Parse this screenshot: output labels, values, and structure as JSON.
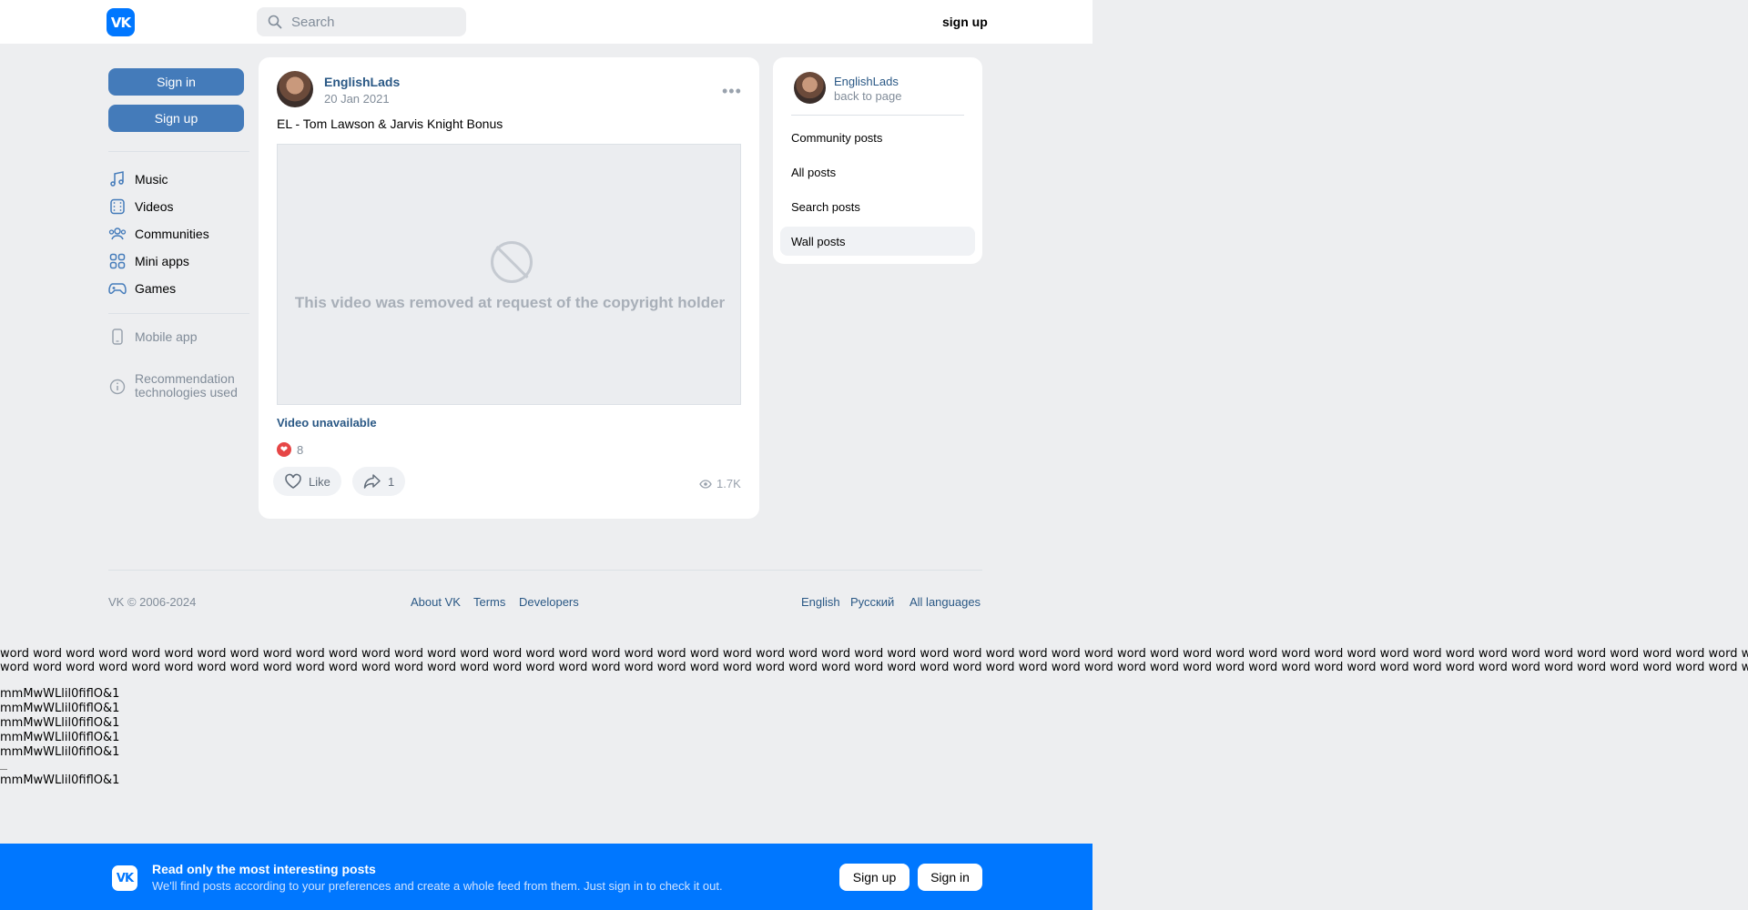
{
  "header": {
    "logo_text": "VK",
    "search_placeholder": "Search",
    "signup_link": "sign up"
  },
  "sidebar": {
    "sign_in": "Sign in",
    "sign_up": "Sign up",
    "items": [
      {
        "label": "Music",
        "icon": "music-icon"
      },
      {
        "label": "Videos",
        "icon": "video-icon"
      },
      {
        "label": "Communities",
        "icon": "communities-icon"
      },
      {
        "label": "Mini apps",
        "icon": "mini-apps-icon"
      },
      {
        "label": "Games",
        "icon": "games-icon"
      }
    ],
    "mobile_app": "Mobile app",
    "recommendation_line1": "Recommendation",
    "recommendation_line2": "technologies used"
  },
  "post": {
    "author": "EnglishLads",
    "date": "20 Jan 2021",
    "text": "EL - Tom Lawson & Jarvis Knight Bonus",
    "video_message": "This video was removed at request of the copyright holder",
    "video_unavailable": "Video unavailable",
    "reaction_count": "8",
    "like_label": "Like",
    "share_count": "1",
    "views": "1.7K"
  },
  "right_card": {
    "name": "EnglishLads",
    "back": "back to page",
    "items": [
      "Community posts",
      "All posts",
      "Search posts",
      "Wall posts"
    ],
    "active_item": "Wall posts"
  },
  "footer": {
    "copyright": "VK © 2006-2024",
    "links": [
      "About VK",
      "Terms",
      "Developers"
    ],
    "languages": [
      "English",
      "Русский",
      "All languages"
    ]
  },
  "test_text": {
    "words_line": "word word word word word word word word word word word word word word word word word word word word word word word word word word word word word word word word word word word word word word word word word word word word word word word word word word word word word word word word word word word word word word word word word word word",
    "mm_line": "mmMwWLlil0fiflO&1"
  },
  "banner": {
    "logo_text": "VK",
    "title": "Read only the most interesting posts",
    "subtitle": "We'll find posts according to your preferences and create a whole feed from them. Just sign in to check it out.",
    "sign_up": "Sign up",
    "sign_in": "Sign in"
  },
  "colors": {
    "brand": "#0077ff",
    "sidebar_button": "#447bba",
    "link": "#2a5885",
    "background": "#edeef0"
  }
}
